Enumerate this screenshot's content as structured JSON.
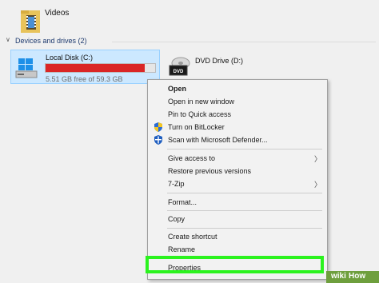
{
  "folders": [
    {
      "label": "Videos",
      "icon": "video-folder-icon"
    }
  ],
  "section": {
    "label": "Devices and drives (2)",
    "expanded": true
  },
  "drives": [
    {
      "name": "Local Disk (C:)",
      "free_text": "5.51 GB free of 59.3 GB",
      "used_fraction": 0.907,
      "bar_color": "#da2626",
      "selected": true,
      "icon": "windows-disk-icon"
    },
    {
      "name": "DVD Drive (D:)",
      "icon": "dvd-drive-icon",
      "icon_text": "DVD"
    }
  ],
  "context_menu": {
    "items": [
      {
        "label": "Open",
        "bold": true
      },
      {
        "label": "Open in new window"
      },
      {
        "label": "Pin to Quick access"
      },
      {
        "label": "Turn on BitLocker",
        "icon": "uac-shield-icon"
      },
      {
        "label": "Scan with Microsoft Defender...",
        "icon": "defender-icon"
      },
      {
        "label": "Give access to",
        "submenu": true
      },
      {
        "label": "Restore previous versions"
      },
      {
        "label": "7-Zip",
        "submenu": true
      },
      {
        "label": "Format..."
      },
      {
        "label": "Copy"
      },
      {
        "label": "Create shortcut"
      },
      {
        "label": "Rename"
      },
      {
        "label": "Properties",
        "highlighted": true
      }
    ]
  },
  "highlight_color": "#2bf31e",
  "watermark": {
    "part1": "wiki",
    "part2": "How"
  }
}
